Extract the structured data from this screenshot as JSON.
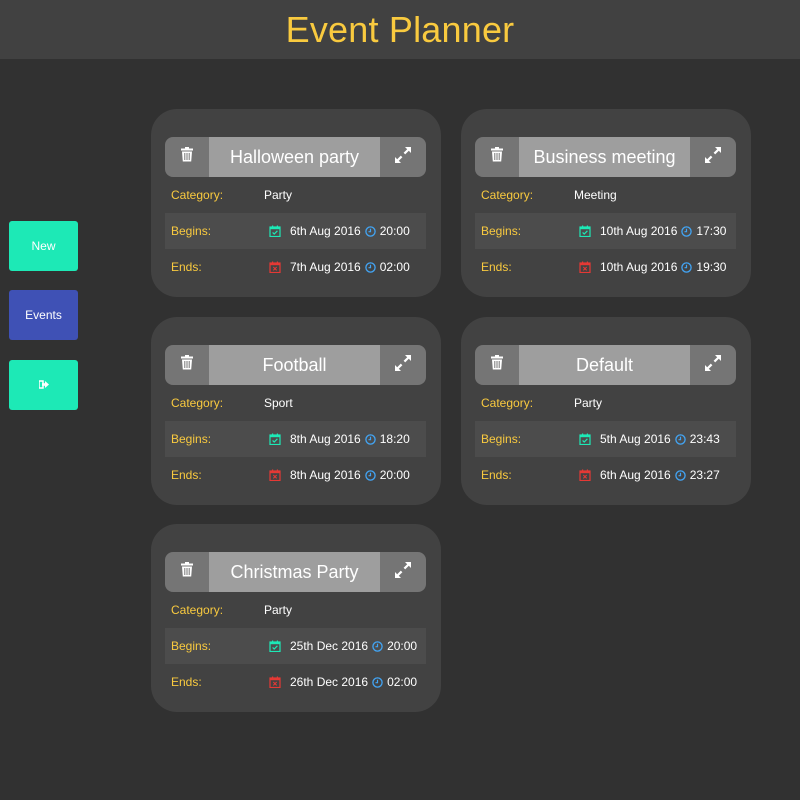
{
  "header": {
    "title": "Event Planner"
  },
  "sidebar": {
    "new_label": "New",
    "events_label": "Events",
    "logout_icon": "sign-out-icon"
  },
  "colors": {
    "accent": "#f9ca3f",
    "teal": "#1de9b6",
    "indigo": "#3f51b5",
    "begin_icon": "#1de9b6",
    "end_icon": "#e53935",
    "clock_icon": "#42a5f5"
  },
  "labels": {
    "category": "Category:",
    "begins": "Begins:",
    "ends": "Ends:"
  },
  "events": [
    {
      "title": "Halloween party",
      "category": "Party",
      "begin_date": "6th Aug 2016",
      "begin_time": "20:00",
      "end_date": "7th Aug 2016",
      "end_time": "02:00"
    },
    {
      "title": "Business meeting",
      "category": "Meeting",
      "begin_date": "10th Aug 2016",
      "begin_time": "17:30",
      "end_date": "10th Aug 2016",
      "end_time": "19:30"
    },
    {
      "title": "Football",
      "category": "Sport",
      "begin_date": "8th Aug 2016",
      "begin_time": "18:20",
      "end_date": "8th Aug 2016",
      "end_time": "20:00"
    },
    {
      "title": "Default",
      "category": "Party",
      "begin_date": "5th Aug 2016",
      "begin_time": "23:43",
      "end_date": "6th Aug 2016",
      "end_time": "23:27"
    },
    {
      "title": "Christmas Party",
      "category": "Party",
      "begin_date": "25th Dec 2016",
      "begin_time": "20:00",
      "end_date": "26th Dec 2016",
      "end_time": "02:00"
    }
  ]
}
